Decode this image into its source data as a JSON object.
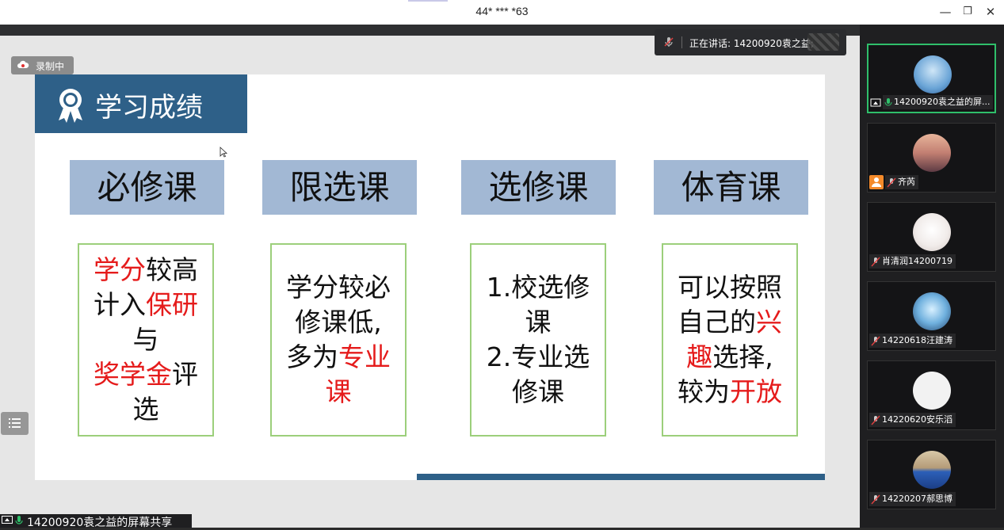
{
  "window": {
    "title": "44* *** *63",
    "minimize": "—",
    "maximize": "❐",
    "close": "✕"
  },
  "speaking": {
    "text": "正在讲话: 14200920袁之益;"
  },
  "recording": {
    "label": "录制中"
  },
  "slide": {
    "heading": "学习成绩",
    "categories": [
      "必修课",
      "限选课",
      "选修课",
      "体育课"
    ],
    "boxes": [
      {
        "lines": [
          [
            "学分|r",
            "较高"
          ],
          [
            "计入",
            "保研|r"
          ],
          [
            "与"
          ],
          [
            "奖学金|r",
            "评"
          ],
          [
            "选"
          ]
        ]
      },
      {
        "lines": [
          [
            "学分较必"
          ],
          [
            "修课低,"
          ],
          [
            "多为",
            "专业|r"
          ],
          [
            "课|r"
          ]
        ]
      },
      {
        "lines": [
          [
            "1.校选修"
          ],
          [
            "课"
          ],
          [
            "2.专业选"
          ],
          [
            "修课"
          ]
        ]
      },
      {
        "lines": [
          [
            "可以按照"
          ],
          [
            "自己的",
            "兴|r"
          ],
          [
            "趣|r",
            "选择,"
          ],
          [
            "较为",
            "开放|r"
          ]
        ]
      }
    ]
  },
  "bottom_label": {
    "text": "14200920袁之益的屏幕共享"
  },
  "participants": [
    {
      "name": "14200920袁之益的屏...",
      "active": true
    },
    {
      "name": "齐芮",
      "active": false
    },
    {
      "name": "肖清润14200719",
      "active": false
    },
    {
      "name": "14220618汪建涛",
      "active": false
    },
    {
      "name": "14220620安乐滔",
      "active": false
    },
    {
      "name": "14220207郝思博",
      "active": false
    }
  ],
  "colors": {
    "accent_blue": "#2e6088",
    "category_bg": "#a2b8d4",
    "box_border": "#9ccf7b",
    "highlight_red": "#e51b1b",
    "active_tile": "#2fbf6a"
  },
  "icons": {
    "medal": "medal-icon",
    "cloud": "cloud-icon",
    "mic_muted": "mic-muted-icon",
    "mic_on": "mic-on-icon",
    "screen_share": "screen-share-icon",
    "list": "list-icon"
  }
}
